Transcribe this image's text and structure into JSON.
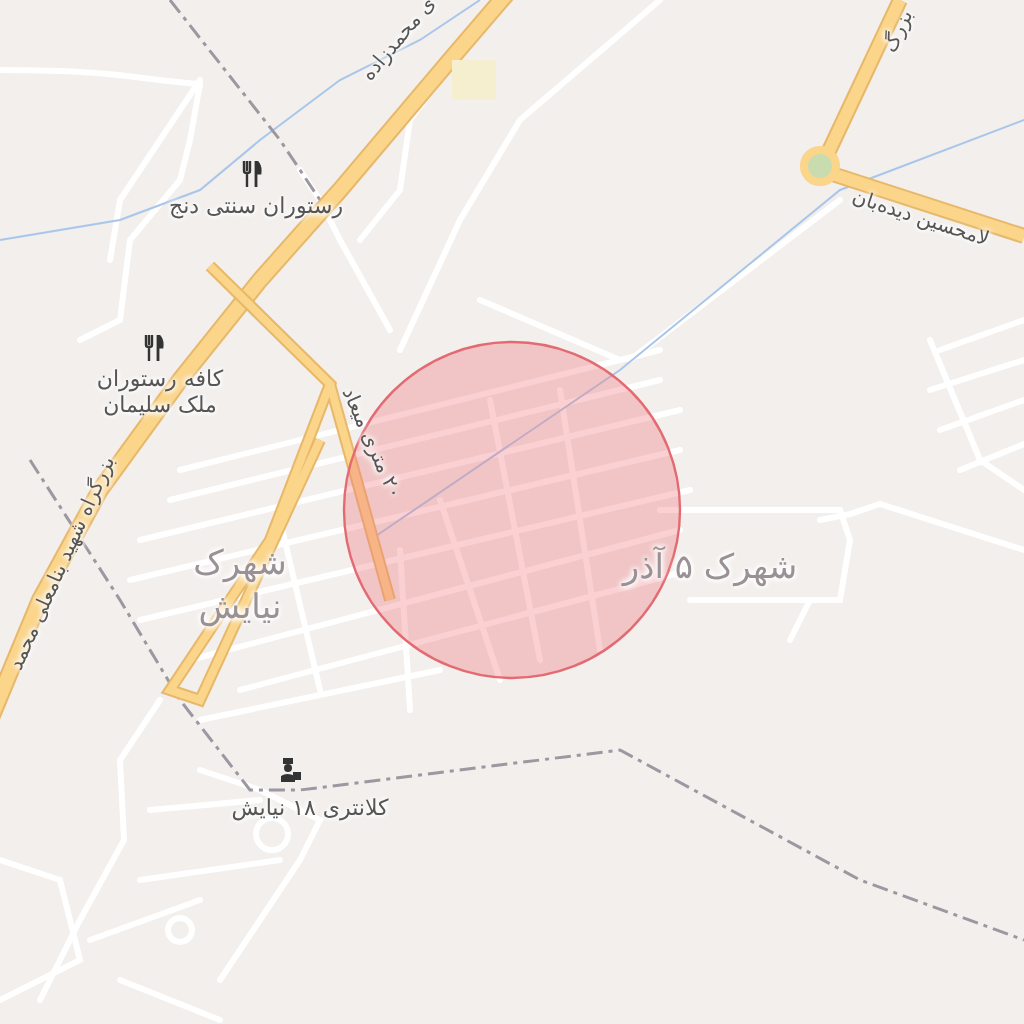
{
  "map": {
    "labels": [
      {
        "kind": "road",
        "lines": [
          "ی محمدزاده"
        ]
      },
      {
        "kind": "restaurant",
        "lines": [
          "رستوران سنتی دنج"
        ]
      },
      {
        "kind": "restaurant",
        "lines": [
          "کافه رستوران",
          "ملک سلیمان"
        ]
      },
      {
        "kind": "road",
        "lines": [
          "۲۰ متری میعاد"
        ]
      },
      {
        "kind": "road",
        "lines": [
          "بزرگراه شهید بنامعلی محمد"
        ]
      },
      {
        "kind": "area",
        "lines": [
          "شهرک ۵ آذر"
        ]
      },
      {
        "kind": "area",
        "lines": [
          "شهرک",
          "نیایش"
        ]
      },
      {
        "kind": "police",
        "lines": [
          "کلانتری ۱۸ نیایش"
        ]
      },
      {
        "kind": "road",
        "lines": [
          "لامحسین دیده‌بان"
        ]
      },
      {
        "kind": "road",
        "lines": [
          "بزرگ"
        ]
      }
    ]
  }
}
